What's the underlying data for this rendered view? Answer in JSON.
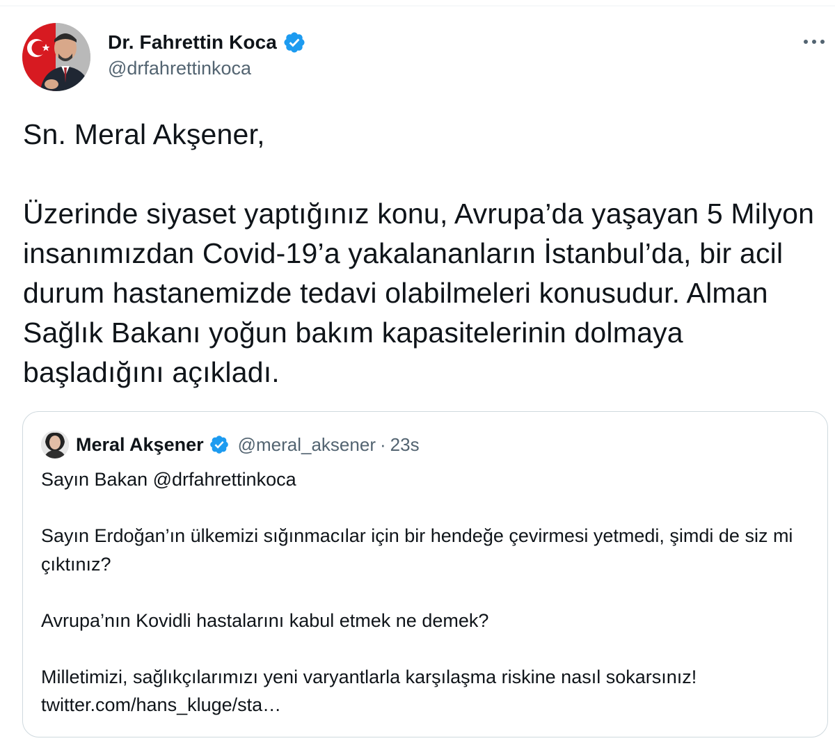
{
  "tweet": {
    "author": {
      "display_name": "Dr. Fahrettin Koca",
      "handle": "@drfahrettinkoca",
      "verified_icon": "verified-badge-icon"
    },
    "more_icon": "more-options-icon",
    "text": "Sn. Meral Akşener,\n\nÜzerinde siyaset yaptığınız konu, Avrupa’da yaşayan 5 Milyon insanımızdan Covid-19’a yakalananların İstanbul’da, bir acil durum hastanemizde tedavi olabilmeleri konusudur. Alman Sağlık Bakanı yoğun bakım kapasitelerinin dolmaya başladığını açıkladı."
  },
  "quoted_tweet": {
    "author": {
      "display_name": "Meral Akşener",
      "handle": "@meral_aksener",
      "verified_icon": "verified-badge-icon"
    },
    "separator": "·",
    "time": "23s",
    "text": "Sayın Bakan @drfahrettinkoca\n\nSayın Erdoğan’ın ülkemizi sığınmacılar için bir hendeğe çevirmesi yetmedi, şimdi de siz mi çıktınız?\n\nAvrupa’nın Kovidli hastalarını kabul etmek ne demek?\n\nMilletimizi, sağlıkçılarımızı yeni varyantlarla karşılaşma riskine nasıl sokarsınız!\ntwitter.com/hans_kluge/sta…"
  },
  "colors": {
    "text_primary": "#0f1419",
    "text_secondary": "#536471",
    "verified_blue": "#1d9bf0",
    "border": "#cfd9de"
  }
}
